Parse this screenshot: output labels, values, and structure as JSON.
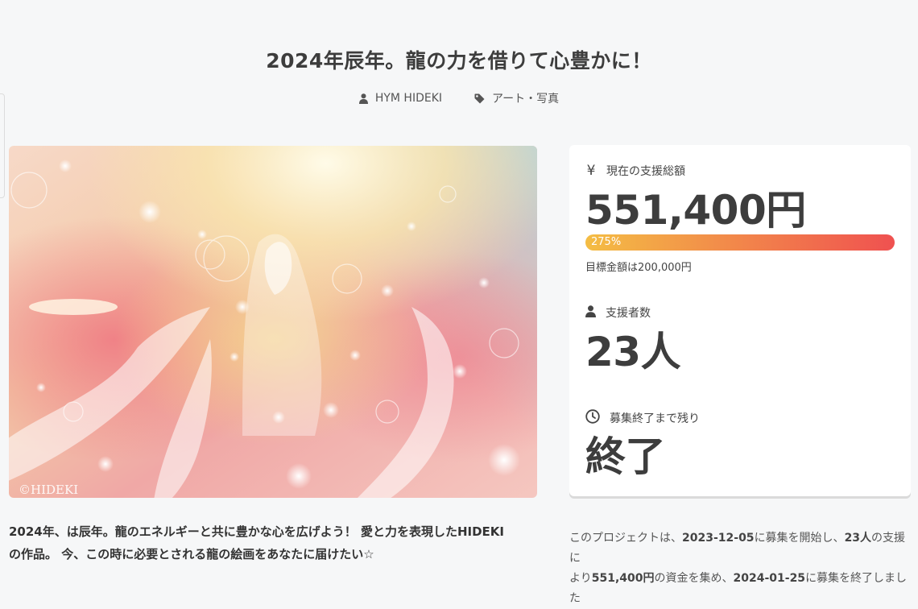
{
  "project": {
    "title": "2024年辰年。龍の力を借りて心豊かに！",
    "author": "HYM HIDEKI",
    "category": "アート・写真",
    "image_caption": "©HIDEKI"
  },
  "stats": {
    "total_label": "現在の支援総額",
    "total_value": "551,400円",
    "progress_text": "275%",
    "progress_percent": 275,
    "goal_text": "目標金額は200,000円",
    "supporters_label": "支援者数",
    "supporters_value": "23人",
    "remaining_label": "募集終了まで残り",
    "remaining_value": "終了"
  },
  "description": {
    "line1": "2024年、は辰年。龍のエネルギーと共に豊かな心を広げよう！ 愛と力を表現したHIDEKI",
    "line2": "の作品。 今、この時に必要とされる龍の絵画をあなたに届けたい☆"
  },
  "summary": {
    "t1": "このプロジェクトは、",
    "start_date": "2023-12-05",
    "t2": "に募集を開始し、",
    "supporters": "23人",
    "t3": "の支援に",
    "t4": "より",
    "amount": "551,400円",
    "t5": "の資金を集め、",
    "end_date": "2024-01-25",
    "t6": "に募集を終了しました"
  },
  "colors": {
    "background": "#f6f7f8",
    "progress_start": "#f4bd44",
    "progress_end": "#ef5150",
    "text": "#3d3d3d"
  },
  "icons": [
    "user-icon",
    "tag-icon",
    "yen-icon",
    "supporter-icon",
    "clock-icon"
  ]
}
